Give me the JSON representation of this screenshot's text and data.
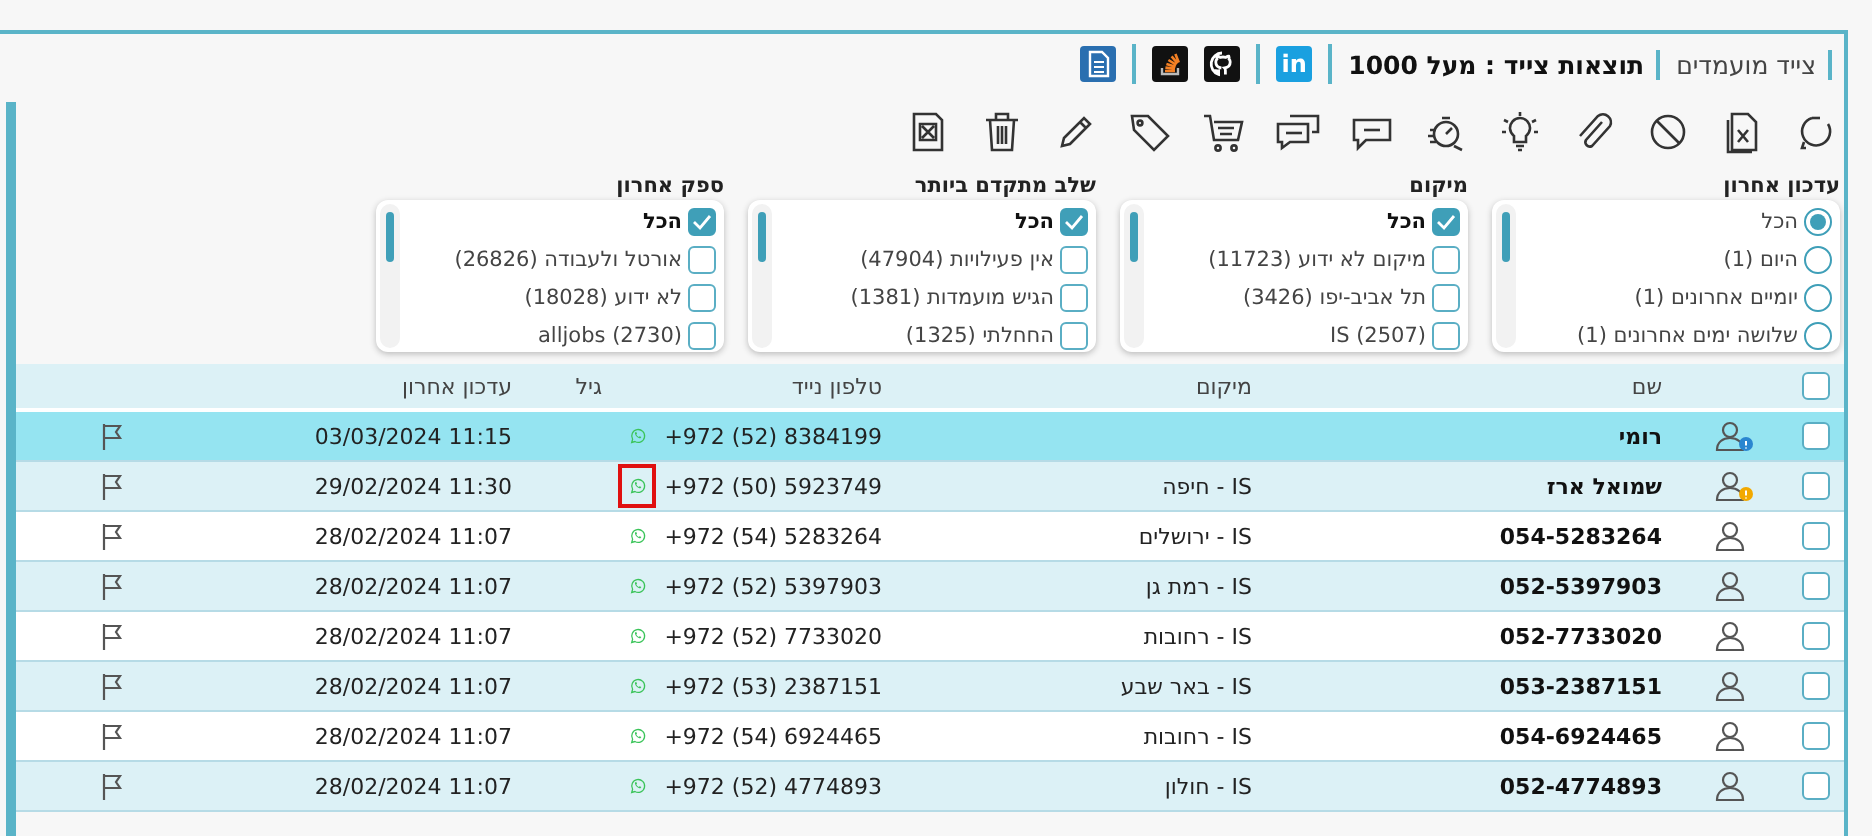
{
  "breadcrumb": [
    {
      "label": "צייד מועמדים",
      "bold": false
    },
    {
      "label": "תוצאות צייד : מעל 1000",
      "bold": true
    }
  ],
  "linkedin_label": "in",
  "filters": [
    {
      "title": "עדכון אחרון",
      "kind": "radio",
      "options": [
        {
          "label": "הכל",
          "selected": true
        },
        {
          "label": "היום (1)",
          "selected": false
        },
        {
          "label": "יומיים אחרונים (1)",
          "selected": false
        },
        {
          "label": "שלושה ימים אחרונים (1)",
          "selected": false
        }
      ]
    },
    {
      "title": "מיקום",
      "kind": "checkbox",
      "options": [
        {
          "label": "הכל",
          "checked": true
        },
        {
          "label": "מיקום לא ידוע (11723)",
          "checked": false
        },
        {
          "label": "תל אביב-יפו (3426)",
          "checked": false
        },
        {
          "label": "IS (2507)",
          "checked": false
        }
      ]
    },
    {
      "title": "שלב מתקדם ביותר",
      "kind": "checkbox",
      "options": [
        {
          "label": "הכל",
          "checked": true
        },
        {
          "label": "אין פעילויות (47904)",
          "checked": false
        },
        {
          "label": "הגיש מועמדות (1381)",
          "checked": false
        },
        {
          "label": "החחלתי (1325)",
          "checked": false
        }
      ]
    },
    {
      "title": "ספק אחרון",
      "kind": "checkbox",
      "options": [
        {
          "label": "הכל",
          "checked": true
        },
        {
          "label": "אורטל ולעבודה (26826)",
          "checked": false
        },
        {
          "label": "לא ידוע (18028)",
          "checked": false
        },
        {
          "label": "alljobs (2730)",
          "checked": false
        }
      ]
    }
  ],
  "table": {
    "columns": [
      "שם",
      "מיקום",
      "טלפון נייד",
      "גיל",
      "עדכון אחרון"
    ],
    "all_checked": false,
    "rows": [
      {
        "selected": true,
        "checked": false,
        "kind": "unknown",
        "name": "רומי",
        "location": "",
        "phone": "+972 (52) 8384199",
        "updated": "03/03/2024 11:15",
        "whatsapp_marked": false
      },
      {
        "selected": false,
        "checked": false,
        "kind": "warning",
        "name": "שמואל ארז",
        "location": "IS - חיפה",
        "phone": "+972 (50) 5923749",
        "updated": "29/02/2024 11:30",
        "whatsapp_marked": true
      },
      {
        "selected": false,
        "checked": false,
        "kind": "plain",
        "name": "054-5283264",
        "location": "IS - ירושלים",
        "phone": "+972 (54) 5283264",
        "updated": "28/02/2024 11:07",
        "whatsapp_marked": false
      },
      {
        "selected": false,
        "checked": false,
        "kind": "plain",
        "name": "052-5397903",
        "location": "IS - רמת גן",
        "phone": "+972 (52) 5397903",
        "updated": "28/02/2024 11:07",
        "whatsapp_marked": false
      },
      {
        "selected": false,
        "checked": false,
        "kind": "plain",
        "name": "052-7733020",
        "location": "IS - רחובות",
        "phone": "+972 (52) 7733020",
        "updated": "28/02/2024 11:07",
        "whatsapp_marked": false
      },
      {
        "selected": false,
        "checked": false,
        "kind": "plain",
        "name": "053-2387151",
        "location": "IS - באר שבע",
        "phone": "+972 (53) 2387151",
        "updated": "28/02/2024 11:07",
        "whatsapp_marked": false
      },
      {
        "selected": false,
        "checked": false,
        "kind": "plain",
        "name": "054-6924465",
        "location": "IS - רחובות",
        "phone": "+972 (54) 6924465",
        "updated": "28/02/2024 11:07",
        "whatsapp_marked": false
      },
      {
        "selected": false,
        "checked": false,
        "kind": "plain",
        "name": "052-4774893",
        "location": "IS - חולון",
        "phone": "+972 (52) 4774893",
        "updated": "28/02/2024 11:07",
        "whatsapp_marked": false
      }
    ]
  }
}
